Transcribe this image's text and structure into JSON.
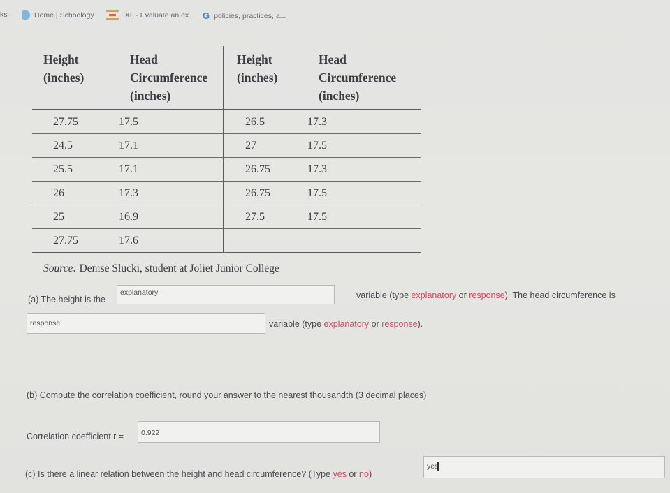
{
  "bookmarks_bar": {
    "items": [
      {
        "label": "ks",
        "icon": "bookmark-cut-off"
      },
      {
        "label": "Home | Schoology",
        "icon": "schoology-icon"
      },
      {
        "label": "IXL - Evaluate an ex...",
        "icon": "ixl-icon"
      },
      {
        "label": "policies, practices, a...",
        "icon": "google-icon"
      }
    ]
  },
  "table": {
    "headers": [
      [
        "Height",
        "(inches)"
      ],
      [
        "Head",
        "Circumference",
        "(inches)"
      ],
      [
        "Height",
        "(inches)"
      ],
      [
        "Head",
        "Circumference",
        "(inches)"
      ]
    ],
    "rows": [
      [
        "27.75",
        "17.5",
        "26.5",
        "17.3"
      ],
      [
        "24.5",
        "17.1",
        "27",
        "17.5"
      ],
      [
        "25.5",
        "17.1",
        "26.75",
        "17.3"
      ],
      [
        "26",
        "17.3",
        "26.75",
        "17.5"
      ],
      [
        "25",
        "16.9",
        "27.5",
        "17.5"
      ],
      [
        "27.75",
        "17.6",
        "",
        ""
      ]
    ],
    "source_label": "Source:",
    "source_text": " Denise Slucki, student at Joliet Junior College"
  },
  "part_a": {
    "prefix": "(a) The height is the",
    "height_answer": "explanatory",
    "mid_text_1": "variable (type ",
    "opt1": "explanatory",
    "or_text": " or ",
    "opt2": "response",
    "mid_text_2": "). The head circumference is",
    "circ_answer": "response",
    "suffix_1": "variable (type ",
    "suffix_2": ")."
  },
  "part_b": {
    "question": "(b) Compute the correlation coefficient, round your answer to the nearest thousandth (3 decimal places)",
    "label": "Correlation coefficient r =",
    "answer": "0.922"
  },
  "part_c": {
    "question_prefix": "(c) Is there a linear relation between the height and head circumference? (Type ",
    "yes": "yes",
    "or_text": " or ",
    "no": "no",
    "question_suffix": ")",
    "answer": "yes"
  },
  "colors": {
    "highlight_red": "#d9485f"
  }
}
